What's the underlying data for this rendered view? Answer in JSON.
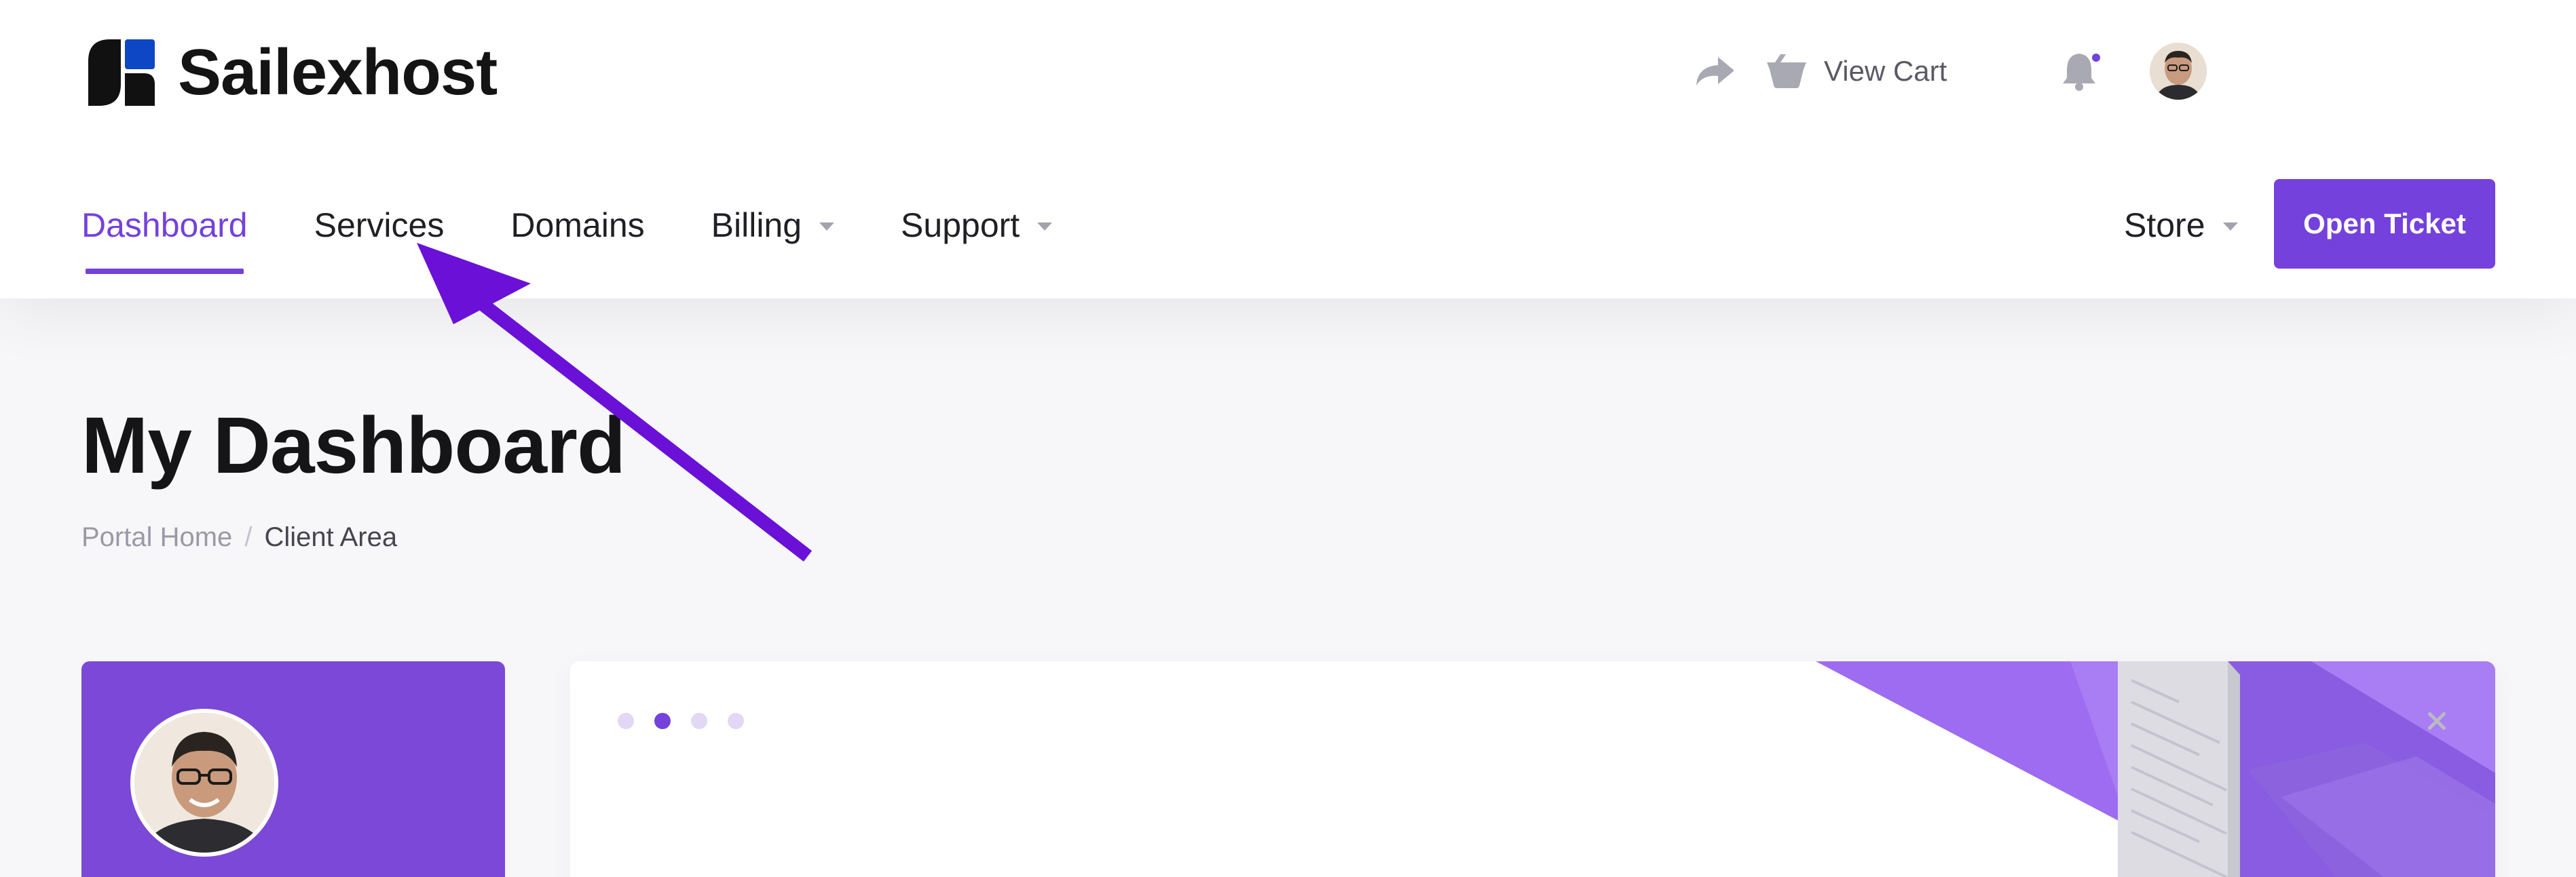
{
  "brand": {
    "name": "Sailexhost",
    "colors": {
      "accent": "#7441dc",
      "logo_blue": "#0d47c6",
      "logo_dark": "#111111"
    }
  },
  "topbar": {
    "share_icon": "share-arrow-icon",
    "cart_icon": "cart-basket-icon",
    "cart_label": "View Cart",
    "bell_icon": "bell-icon",
    "has_notification": true
  },
  "nav": {
    "items": [
      {
        "label": "Dashboard",
        "active": true,
        "dropdown": false
      },
      {
        "label": "Services",
        "active": false,
        "dropdown": false
      },
      {
        "label": "Domains",
        "active": false,
        "dropdown": false
      },
      {
        "label": "Billing",
        "active": false,
        "dropdown": true
      },
      {
        "label": "Support",
        "active": false,
        "dropdown": true
      }
    ],
    "store_label": "Store",
    "open_ticket_label": "Open Ticket"
  },
  "page": {
    "title": "My Dashboard",
    "breadcrumb": {
      "home": "Portal Home",
      "separator": "/",
      "current": "Client Area"
    }
  },
  "promo": {
    "slides": 4,
    "active_slide": 2,
    "close_icon": "close-icon"
  }
}
